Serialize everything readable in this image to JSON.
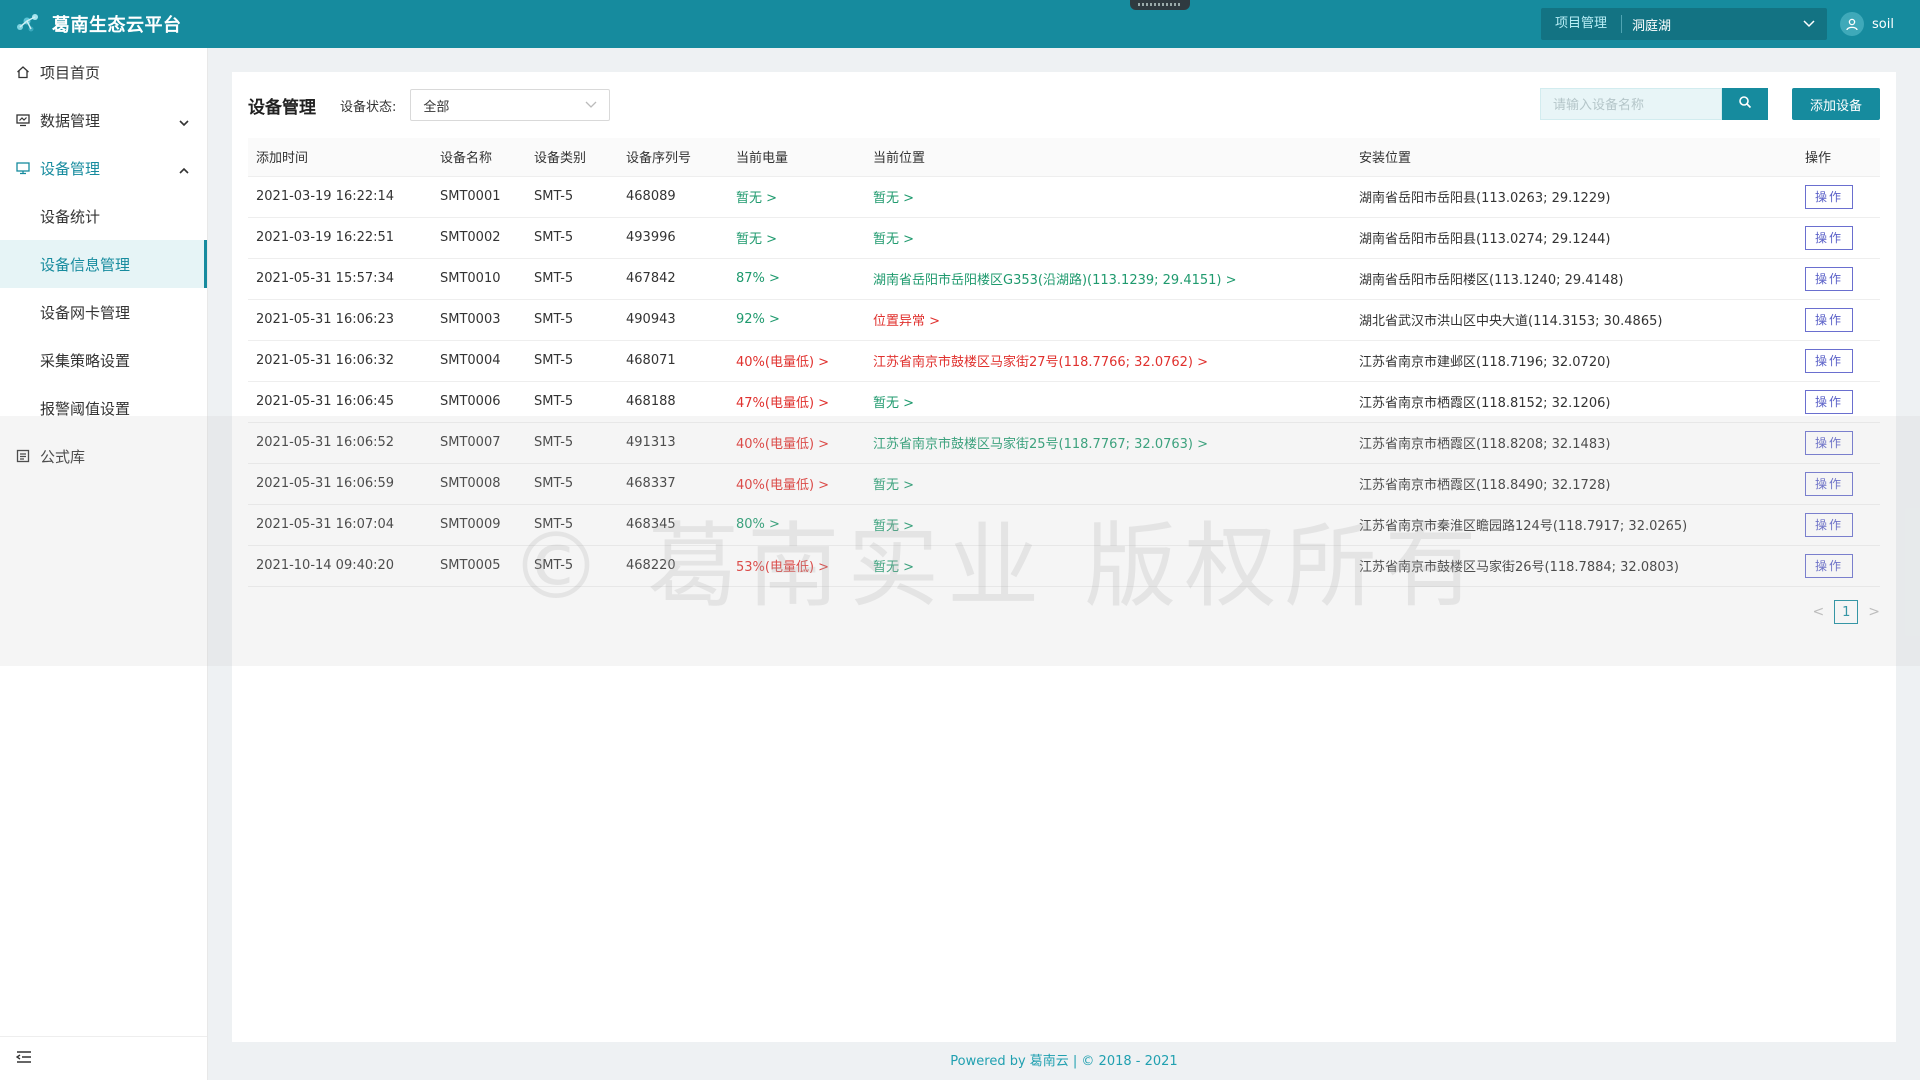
{
  "app": {
    "title": "葛南生态云平台"
  },
  "header": {
    "project_label": "项目管理",
    "project_value": "洞庭湖",
    "username": "soil"
  },
  "sidebar": {
    "items": [
      {
        "label": "项目首页"
      },
      {
        "label": "数据管理"
      },
      {
        "label": "设备管理"
      },
      {
        "label": "公式库"
      }
    ],
    "subitems": [
      {
        "label": "设备统计"
      },
      {
        "label": "设备信息管理"
      },
      {
        "label": "设备网卡管理"
      },
      {
        "label": "采集策略设置"
      },
      {
        "label": "报警阈值设置"
      }
    ]
  },
  "page": {
    "title": "设备管理",
    "filter_label": "设备状态:",
    "filter_value": "全部",
    "search_placeholder": "请输入设备名称",
    "add_button": "添加设备"
  },
  "table": {
    "columns": [
      "添加时间",
      "设备名称",
      "设备类别",
      "设备序列号",
      "当前电量",
      "当前位置",
      "安装位置",
      "操作"
    ],
    "rows": [
      {
        "time": "2021-03-19 16:22:14",
        "name": "SMT0001",
        "type": "SMT-5",
        "serial": "468089",
        "battery": "暂无 >",
        "battery_status": "green",
        "location": "暂无 >",
        "location_status": "green",
        "install": "湖南省岳阳市岳阳县(113.0263; 29.1229)",
        "op": "操作"
      },
      {
        "time": "2021-03-19 16:22:51",
        "name": "SMT0002",
        "type": "SMT-5",
        "serial": "493996",
        "battery": "暂无 >",
        "battery_status": "green",
        "location": "暂无 >",
        "location_status": "green",
        "install": "湖南省岳阳市岳阳县(113.0274; 29.1244)",
        "op": "操作"
      },
      {
        "time": "2021-05-31 15:57:34",
        "name": "SMT0010",
        "type": "SMT-5",
        "serial": "467842",
        "battery": "87% >",
        "battery_status": "green",
        "location": "湖南省岳阳市岳阳楼区G353(沿湖路)(113.1239; 29.4151) >",
        "location_status": "green",
        "install": "湖南省岳阳市岳阳楼区(113.1240; 29.4148)",
        "op": "操作"
      },
      {
        "time": "2021-05-31 16:06:23",
        "name": "SMT0003",
        "type": "SMT-5",
        "serial": "490943",
        "battery": "92% >",
        "battery_status": "green",
        "location": "位置异常 >",
        "location_status": "red",
        "install": "湖北省武汉市洪山区中央大道(114.3153; 30.4865)",
        "op": "操作"
      },
      {
        "time": "2021-05-31 16:06:32",
        "name": "SMT0004",
        "type": "SMT-5",
        "serial": "468071",
        "battery": "40%(电量低) >",
        "battery_status": "red",
        "location": "江苏省南京市鼓楼区马家街27号(118.7766; 32.0762) >",
        "location_status": "red",
        "install": "江苏省南京市建邺区(118.7196; 32.0720)",
        "op": "操作"
      },
      {
        "time": "2021-05-31 16:06:45",
        "name": "SMT0006",
        "type": "SMT-5",
        "serial": "468188",
        "battery": "47%(电量低) >",
        "battery_status": "red",
        "location": "暂无 >",
        "location_status": "green",
        "install": "江苏省南京市栖霞区(118.8152; 32.1206)",
        "op": "操作"
      },
      {
        "time": "2021-05-31 16:06:52",
        "name": "SMT0007",
        "type": "SMT-5",
        "serial": "491313",
        "battery": "40%(电量低) >",
        "battery_status": "red",
        "location": "江苏省南京市鼓楼区马家街25号(118.7767; 32.0763) >",
        "location_status": "green",
        "install": "江苏省南京市栖霞区(118.8208; 32.1483)",
        "op": "操作"
      },
      {
        "time": "2021-05-31 16:06:59",
        "name": "SMT0008",
        "type": "SMT-5",
        "serial": "468337",
        "battery": "40%(电量低) >",
        "battery_status": "red",
        "location": "暂无 >",
        "location_status": "green",
        "install": "江苏省南京市栖霞区(118.8490; 32.1728)",
        "op": "操作"
      },
      {
        "time": "2021-05-31 16:07:04",
        "name": "SMT0009",
        "type": "SMT-5",
        "serial": "468345",
        "battery": "80% >",
        "battery_status": "green",
        "location": "暂无 >",
        "location_status": "green",
        "install": "江苏省南京市秦淮区瞻园路124号(118.7917; 32.0265)",
        "op": "操作"
      },
      {
        "time": "2021-10-14 09:40:20",
        "name": "SMT0005",
        "type": "SMT-5",
        "serial": "468220",
        "battery": "53%(电量低) >",
        "battery_status": "red",
        "location": "暂无 >",
        "location_status": "green",
        "install": "江苏省南京市鼓楼区马家街26号(118.7884; 32.0803)",
        "op": "操作"
      }
    ]
  },
  "pagination": {
    "current": "1"
  },
  "watermark": "© 葛南实业 版权所有",
  "footer": {
    "text": "Powered by 葛南云 | © 2018 - 2021"
  },
  "colors": {
    "brand": "#168b9e",
    "ok": "#1f9a6e",
    "alert": "#e0312e",
    "op": "#5b61c8"
  },
  "icons": [
    "logo-icon",
    "home-icon",
    "data-icon",
    "device-icon",
    "formula-icon",
    "chevron-down-icon",
    "chevron-up-icon",
    "search-icon",
    "user-icon",
    "menu-collapse-icon"
  ]
}
